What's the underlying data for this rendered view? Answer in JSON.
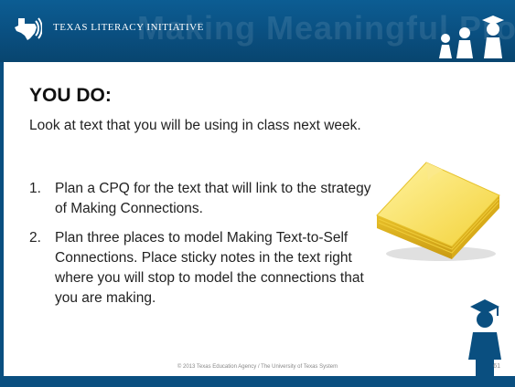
{
  "header": {
    "org_name": "TEXAS LITERACY INITIATIVE",
    "watermark": "Making Meaningful Progress"
  },
  "content": {
    "title": "YOU DO:",
    "intro": "Look at text that you will be using in class next week.",
    "items": [
      {
        "number": "1.",
        "text": "Plan a CPQ for the text that will link to the strategy of Making Connections."
      },
      {
        "number": "2.",
        "text": "Plan three places to model Making Text-to-Self Connections. Place sticky notes in the text right where you will stop to model the connections that you are making."
      }
    ]
  },
  "footer": {
    "copyright": "© 2013 Texas Education Agency / The University of Texas System",
    "page_number": "61"
  },
  "colors": {
    "header_blue": "#0a4f80",
    "sticky_yellow": "#f5d845"
  },
  "icons": [
    "texas-logo-icon",
    "graduate-figures-icon",
    "sticky-notes-icon",
    "graduate-figure-icon"
  ]
}
